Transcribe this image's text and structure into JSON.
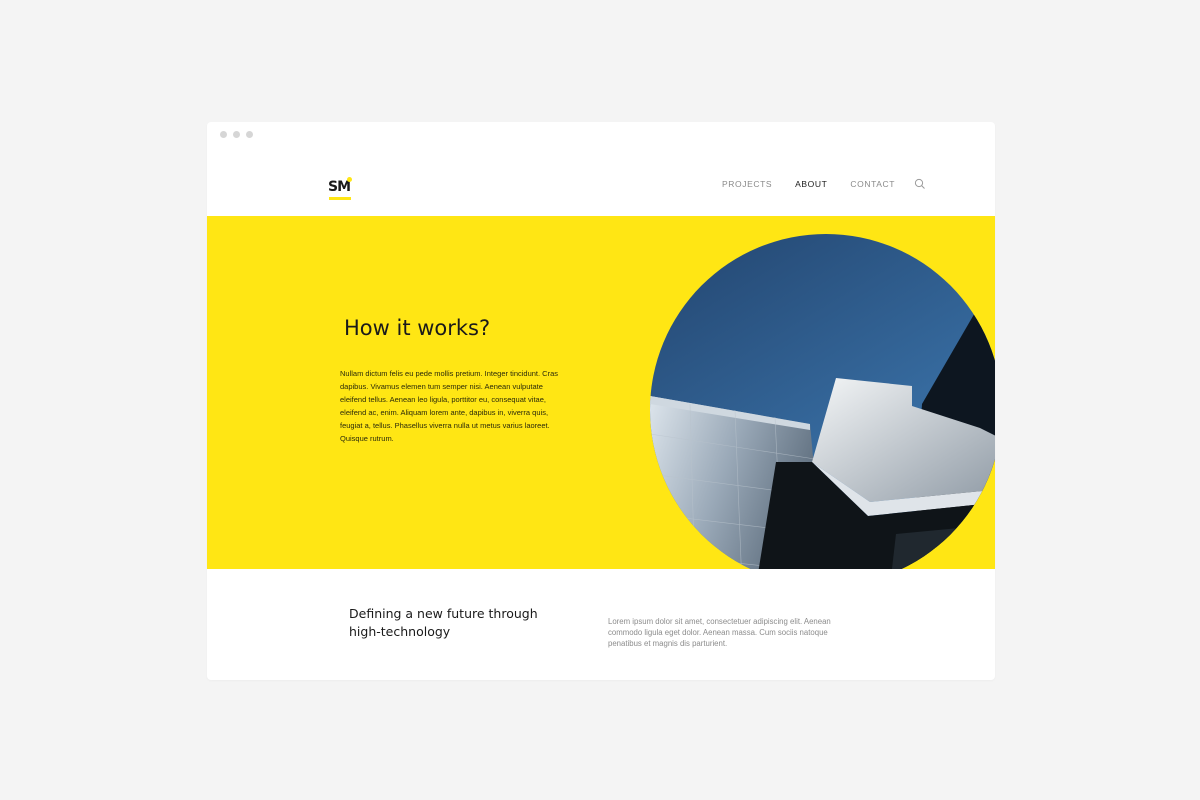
{
  "brand": {
    "logo_text": "SM",
    "accent_color": "#ffe614"
  },
  "nav": {
    "items": [
      {
        "label": "PROJECTS",
        "active": false
      },
      {
        "label": "ABOUT",
        "active": true
      },
      {
        "label": "CONTACT",
        "active": false
      }
    ],
    "search_icon": "search-icon"
  },
  "hero": {
    "title": "How it works?",
    "body": " Nullam dictum felis eu pede mollis pretium. Integer tincidunt. Cras dapibus. Vivamus elemen tum semper nisi. Aenean vulputate eleifend tellus. Aenean leo ligula, porttitor eu, consequat vitae, eleifend ac, enim. Aliquam lorem ante, dapibus in, viverra quis, feugiat a, tellus. Phasellus viverra nulla ut metus varius laoreet. Quisque rutrum.",
    "background_color": "#ffe614"
  },
  "section": {
    "title": "Defining a new future through high-technology",
    "body": "Lorem ipsum dolor sit amet, consectetuer adipiscing elit. Aenean commodo ligula eget dolor. Aenean massa. Cum sociis natoque penatibus et magnis dis parturient."
  }
}
